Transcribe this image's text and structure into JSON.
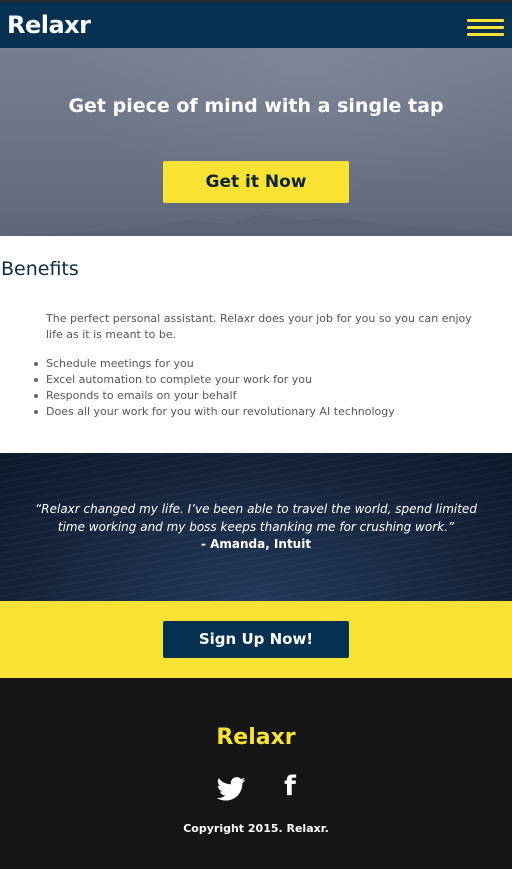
{
  "colors": {
    "navy": "#073150",
    "yellow": "#f9e234",
    "footer_bg": "#151515"
  },
  "navbar": {
    "brand": "Relaxr",
    "menu_icon": "hamburger-icon"
  },
  "hero": {
    "title": "Get piece of mind with a single tap",
    "cta_label": "Get it Now"
  },
  "benefits": {
    "heading": "Benefits",
    "intro": "The perfect personal assistant. Relaxr does your job for you so you can enjoy life as it is meant to be.",
    "items": [
      "Schedule meetings for you",
      "Excel automation to complete your work for you",
      "Responds to emails on your behalf",
      "Does all your work for you with our revolutionary AI technology"
    ]
  },
  "testimonial": {
    "quote": "“Relaxr changed my life. I’ve been able to travel the world, spend limited time working and my boss keeps thanking me for crushing work.”",
    "author": "- Amanda, Intuit"
  },
  "signup": {
    "cta_label": "Sign Up Now!"
  },
  "footer": {
    "brand": "Relaxr",
    "social": [
      "twitter-icon",
      "facebook-icon"
    ],
    "facebook_glyph": "f",
    "copyright": "Copyright 2015. Relaxr."
  }
}
